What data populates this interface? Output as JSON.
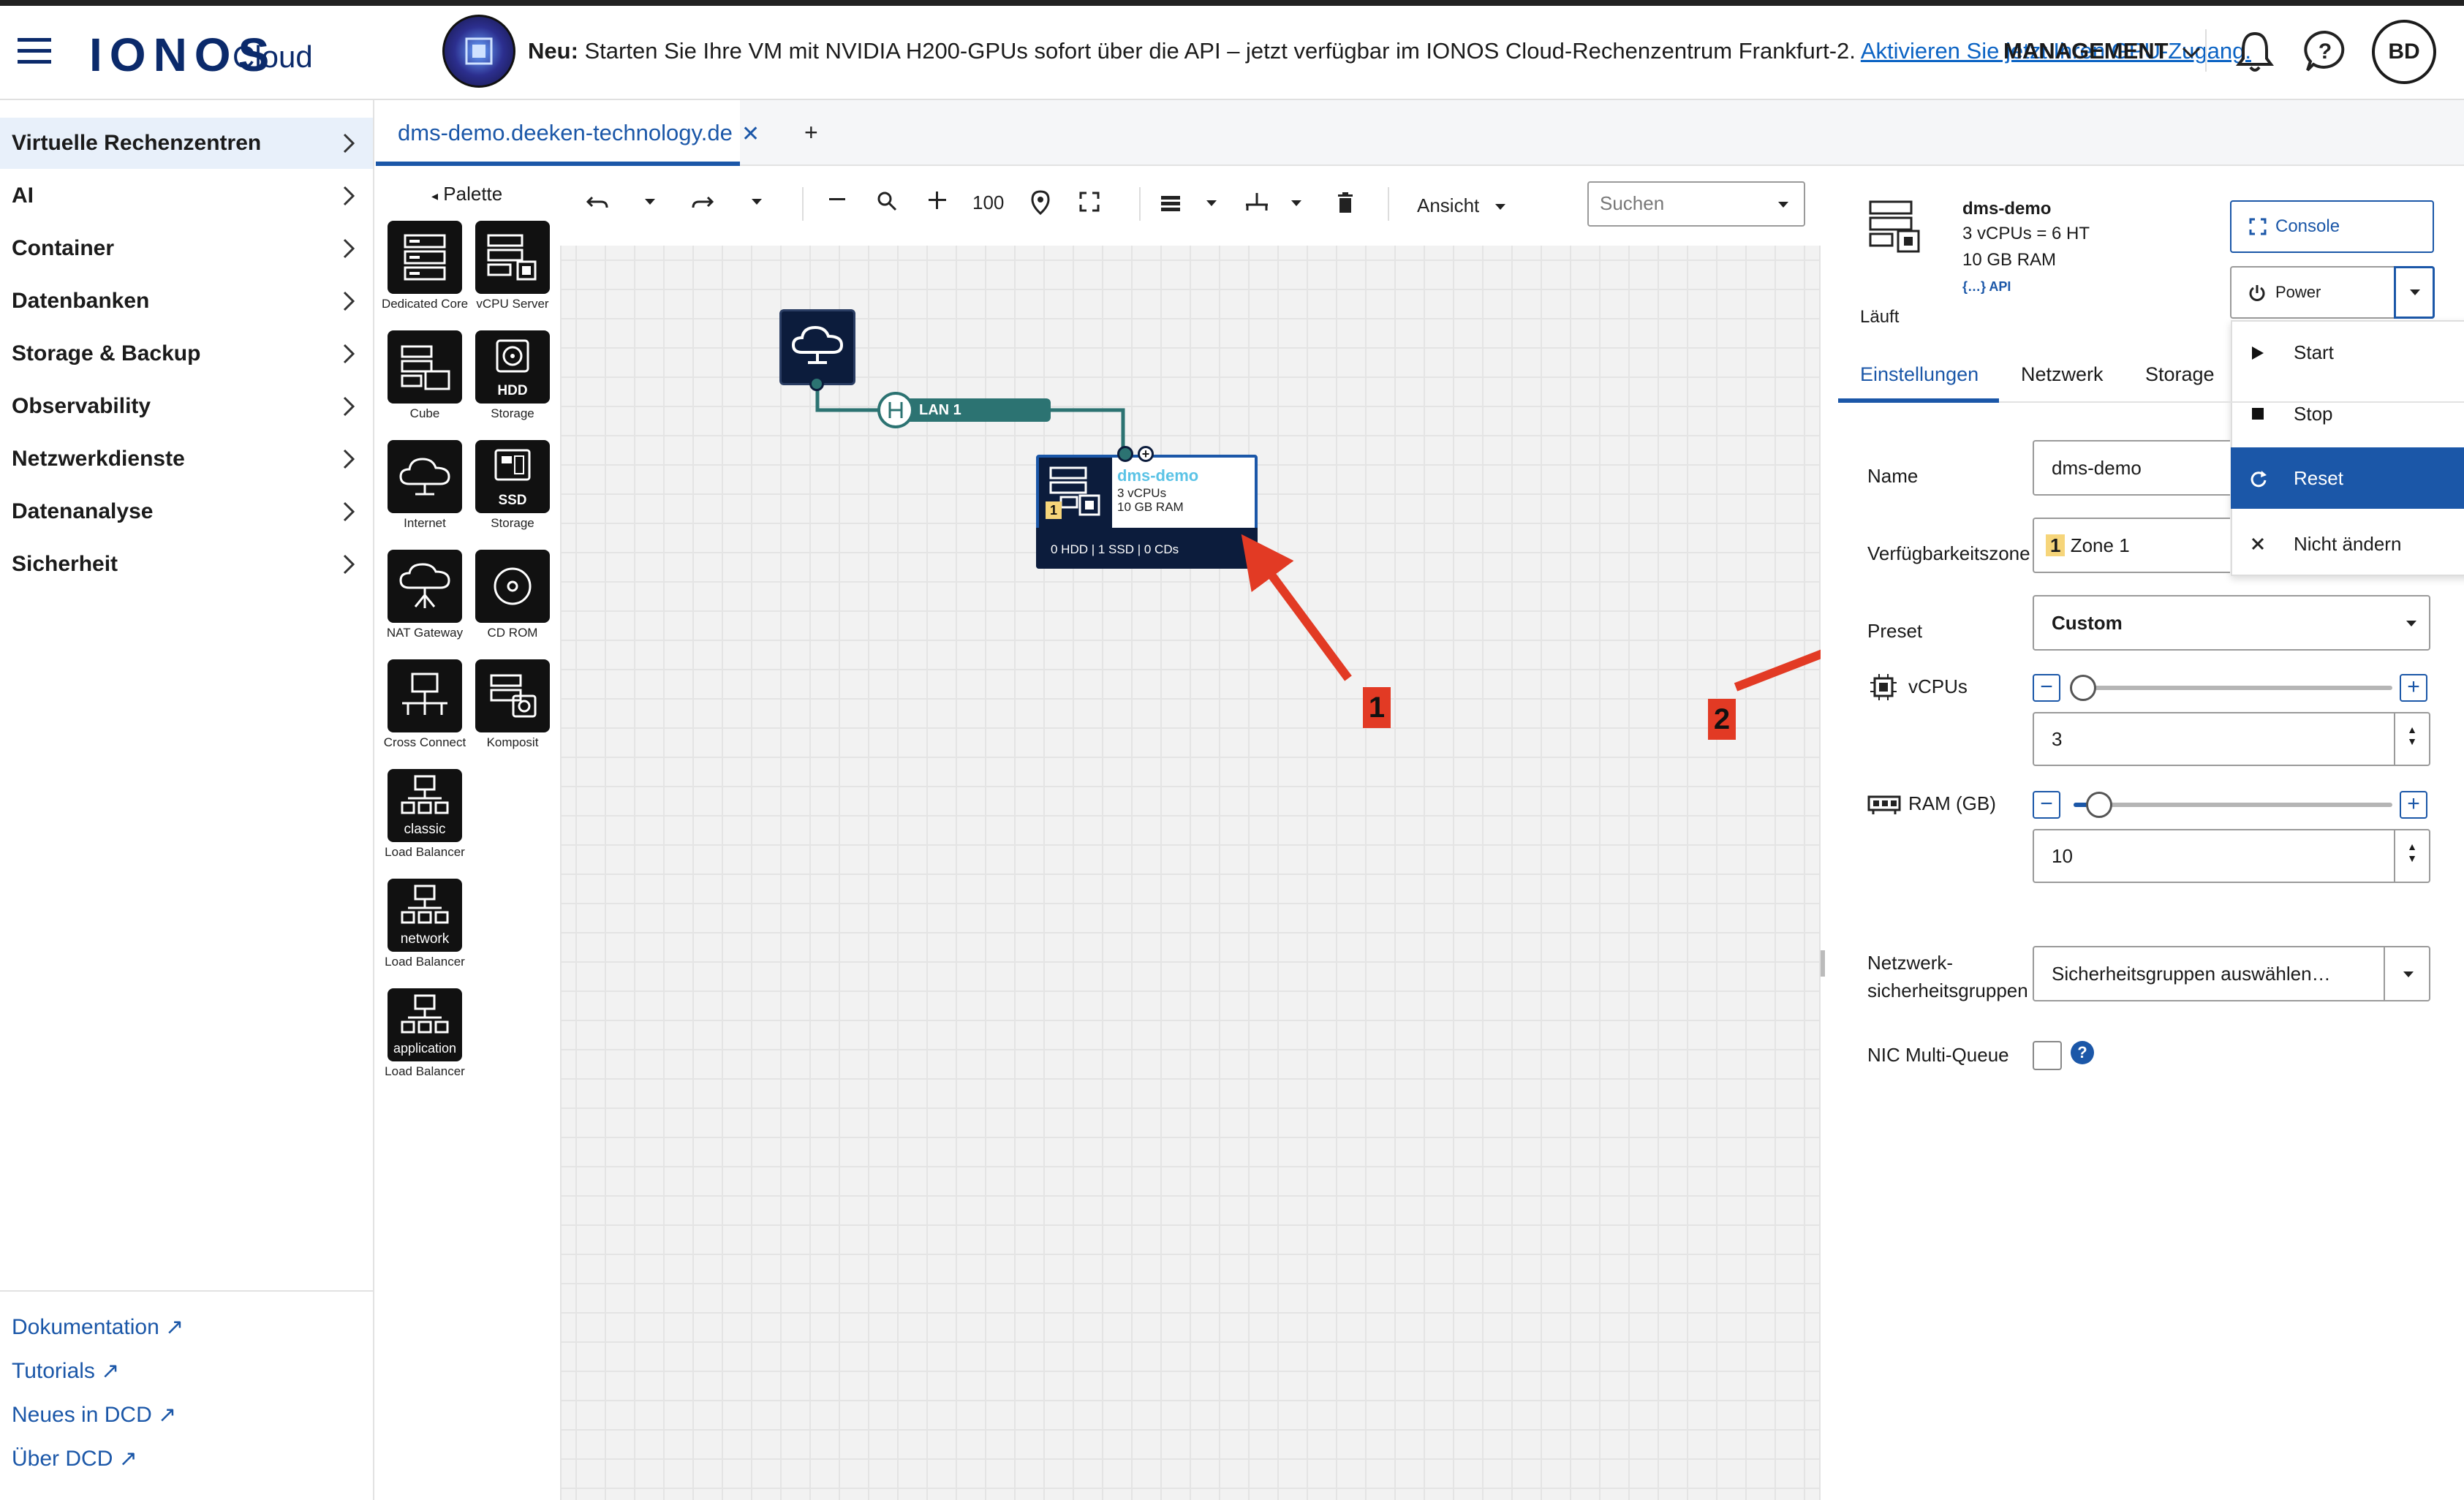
{
  "header": {
    "brand": "IONOS",
    "brand_sub": "Cloud",
    "news_bold": "Neu:",
    "news_text": " Starten Sie Ihre VM mit NVIDIA H200-GPUs sofort über die API – jetzt verfügbar im IONOS Cloud-Rechenzentrum Frankfurt-2. ",
    "news_link": "Aktivieren Sie jetzt Ihren GPU-Zugang.",
    "management": "MANAGEMENT",
    "avatar": "BD"
  },
  "sidebar": {
    "items": [
      {
        "label": "Virtuelle Rechenzentren"
      },
      {
        "label": "AI"
      },
      {
        "label": "Container"
      },
      {
        "label": "Datenbanken"
      },
      {
        "label": "Storage & Backup"
      },
      {
        "label": "Observability"
      },
      {
        "label": "Netzwerkdienste"
      },
      {
        "label": "Datenanalyse"
      },
      {
        "label": "Sicherheit"
      }
    ],
    "footer": [
      {
        "label": "Dokumentation"
      },
      {
        "label": "Tutorials"
      },
      {
        "label": "Neues in DCD"
      },
      {
        "label": "Über DCD"
      }
    ]
  },
  "tabs": {
    "active": "dms-demo.deeken-technology.de",
    "add": "+"
  },
  "palette": {
    "title": "Palette",
    "items": [
      {
        "caption": "Dedicated Core",
        "inner": ""
      },
      {
        "caption": "vCPU Server",
        "inner": ""
      },
      {
        "caption": "Cube",
        "inner": ""
      },
      {
        "caption": "Storage",
        "inner": "HDD"
      },
      {
        "caption": "Internet",
        "inner": ""
      },
      {
        "caption": "Storage",
        "inner": "SSD"
      },
      {
        "caption": "NAT Gateway",
        "inner": ""
      },
      {
        "caption": "CD ROM",
        "inner": ""
      },
      {
        "caption": "Cross Connect",
        "inner": ""
      },
      {
        "caption": "Komposit",
        "inner": ""
      },
      {
        "caption": "Load Balancer",
        "inner": "classic"
      },
      {
        "caption": "Load Balancer",
        "inner": "network"
      },
      {
        "caption": "Load Balancer",
        "inner": "application"
      }
    ]
  },
  "toolbar": {
    "zoom": "100",
    "view": "Ansicht",
    "search_placeholder": "Suchen"
  },
  "canvas": {
    "lan": "LAN 1",
    "node": {
      "name": "dms-demo",
      "cpu": "3 vCPUs",
      "ram": "10 GB RAM",
      "storage": "0 HDD | 1 SSD | 0 CDs",
      "zone_badge": "1"
    }
  },
  "panel": {
    "name": "dms-demo",
    "spec_cpu": "3 vCPUs = 6 HT",
    "spec_ram": "10 GB RAM",
    "api": "{…} API",
    "status": "Läuft",
    "console": "Console",
    "power": "Power",
    "power_menu": [
      {
        "label": "Start"
      },
      {
        "label": "Stop"
      },
      {
        "label": "Reset"
      },
      {
        "label": "Nicht ändern"
      }
    ],
    "tabs": [
      {
        "label": "Einstellungen"
      },
      {
        "label": "Netzwerk"
      },
      {
        "label": "Storage"
      }
    ],
    "fields": {
      "name_label": "Name",
      "name_value": "dms-demo",
      "zone_label": "Verfügbarkeitszone",
      "zone_badge": "1",
      "zone_value": "Zone 1",
      "preset_label": "Preset",
      "preset_value": "Custom",
      "vcpu_label": "vCPUs",
      "vcpu_value": "3",
      "vcpu_slider_fraction": 0.03,
      "ram_label": "RAM (GB)",
      "ram_value": "10",
      "ram_slider_fraction": 0.08,
      "sg_label_1": "Netzwerk-",
      "sg_label_2": "sicherheitsgruppen",
      "sg_value": "Sicherheitsgruppen auswählen…",
      "nic_label": "NIC Multi-Queue",
      "nic_help": "?"
    }
  },
  "annotations": {
    "one": "1",
    "two": "2"
  },
  "colors": {
    "accent": "#1b57a8",
    "brand": "#0b2a6b",
    "lan": "#2c7372",
    "annotation": "#e23a24"
  }
}
